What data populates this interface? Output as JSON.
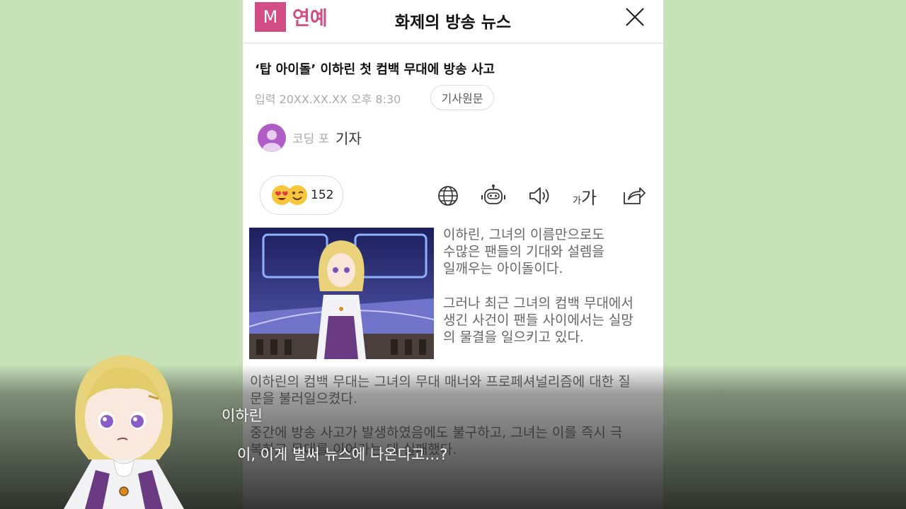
{
  "header": {
    "logo_letter": "M",
    "logo_text": "연예",
    "title": "화제의 방송 뉴스",
    "close_icon": "close-icon"
  },
  "article": {
    "headline": "‘탑 아이돌’ 이하린 첫 컴백 무대에 방송 사고",
    "date": "입력 20XX.XX.XX  오후 8:30",
    "original_button": "기사원문",
    "reporter_name": "코딩 포",
    "reporter_suffix": "기자",
    "reaction_count": "152",
    "toolbar_icons": [
      "globe-icon",
      "robot-icon",
      "speaker-icon",
      "text-size-icon",
      "share-icon"
    ],
    "text_size_small": "가",
    "text_size_big": "가",
    "paragraph_1": "이하린, 그녀의 이름만으로도\n수많은 팬들의 기대와 설렘을\n일깨우는 아이돌이다.",
    "paragraph_2": "그러나 최근 그녀의 컴백 무대에서\n생긴 사건이 팬들 사이에서는 실망\n의 물결을 일으키고 있다.",
    "paragraph_3": "이하린의 컴백 무대는 그녀의 무대 매너와 프로페셔널리즘에 대한 질\n문을 불러일으켰다.",
    "paragraph_4": "중간에 방송 사고가 발생하였음에도 불구하고, 그녀는 이를 즉시 극\n복하고 무대를 이어가는 데 실패했다."
  },
  "dialogue": {
    "speaker": "이하린",
    "line": "이, 이게 벌써 뉴스에 나온다고…?"
  },
  "colors": {
    "background": "#c5e2b8",
    "brand": "#d24c86",
    "avatar": "#b05cc6"
  }
}
